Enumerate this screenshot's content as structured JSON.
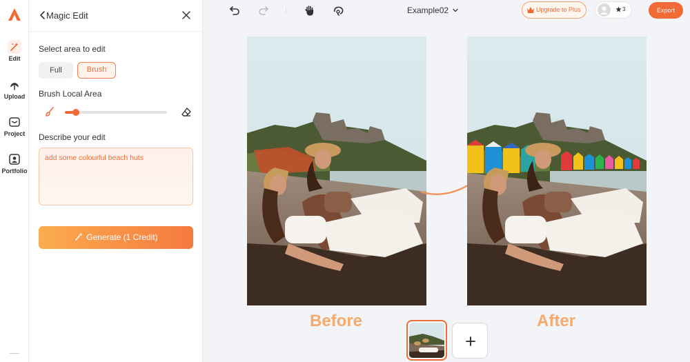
{
  "rail": {
    "items": [
      {
        "label": "Edit",
        "icon": "magic-wand-icon"
      },
      {
        "label": "Upload",
        "icon": "upload-icon"
      },
      {
        "label": "Project",
        "icon": "project-icon"
      },
      {
        "label": "Portfolio",
        "icon": "portfolio-icon"
      }
    ]
  },
  "panel": {
    "title": "Magic Edit",
    "select_area_label": "Select area to edit",
    "mode_full": "Full",
    "mode_brush": "Brush",
    "brush_area_label": "Brush Local Area",
    "brush_size": 0.11,
    "describe_label": "Describe your edit",
    "edit_text": "add some colourful beach huts",
    "generate_label": "Generate (1 Credit)"
  },
  "toolbar": {
    "file_name": "Example02",
    "upgrade_label": "Upgrade to Plus",
    "credits": "3",
    "export_label": "Export"
  },
  "canvas": {
    "before_label": "Before",
    "after_label": "After"
  },
  "colors": {
    "accent": "#f06a35",
    "caption": "#f5aa6e"
  }
}
